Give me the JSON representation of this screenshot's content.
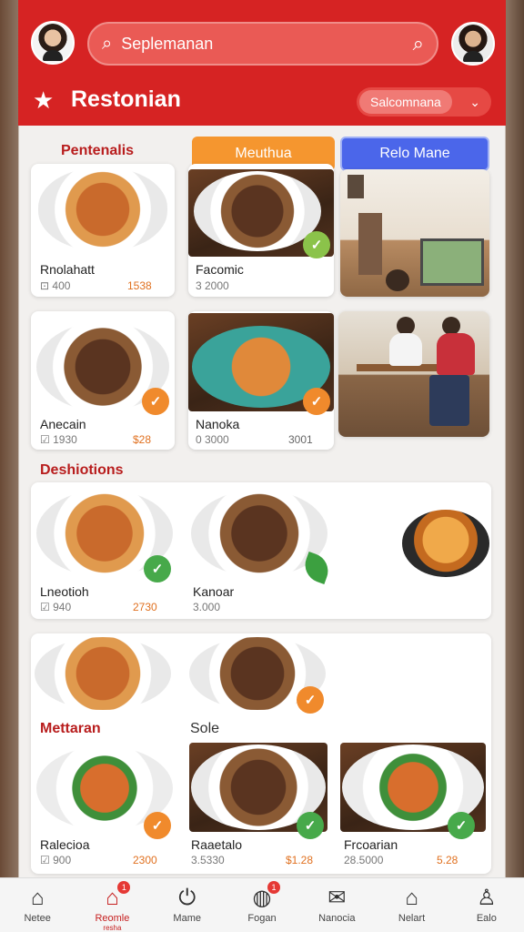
{
  "header": {
    "search_text": "Seplemanan",
    "brand_title": "Restonian",
    "select_value": "Salcomnana"
  },
  "sections": {
    "first": "Pentenalis",
    "second": "Deshiotions",
    "third_left": "Mettaran",
    "third_right": "Sole"
  },
  "tabs": [
    {
      "label": "Meuthua",
      "color": "#f5962f"
    },
    {
      "label": "Relo Mane",
      "color": "#4b66ea"
    }
  ],
  "cards": [
    {
      "name": "Rnolahatt",
      "meta": "400",
      "price": "1538"
    },
    {
      "name": "Facomic",
      "meta": "3 2000",
      "price": ""
    },
    {
      "name": "Anecain",
      "meta": "1930",
      "price": "$28"
    },
    {
      "name": "Nanoka",
      "meta": "0 3000",
      "price": "3001"
    },
    {
      "name": "Lneotioh",
      "meta": "940",
      "price": "2730"
    },
    {
      "name": "Kanoar",
      "meta": "3.000",
      "price": ""
    },
    {
      "name": "Ralecioa",
      "meta": "900",
      "price": "2300"
    },
    {
      "name": "Raaetalo",
      "meta": "3.5330",
      "price": "$1.28"
    },
    {
      "name": "Frcoarian",
      "meta": "28.5000",
      "price": "5.28"
    }
  ],
  "nav": [
    {
      "label": "Netee",
      "icon": "home-icon",
      "glyph": "⌂",
      "badge": ""
    },
    {
      "label": "Reomle",
      "icon": "store-icon",
      "glyph": "⌂",
      "badge": "1",
      "sub": "resha"
    },
    {
      "label": "Mame",
      "icon": "power-icon",
      "glyph": "⏻",
      "badge": ""
    },
    {
      "label": "Fogan",
      "icon": "chat-icon",
      "glyph": "◍",
      "badge": "1"
    },
    {
      "label": "Nanocia",
      "icon": "mail-icon",
      "glyph": "✉",
      "badge": ""
    },
    {
      "label": "Nelart",
      "icon": "house-icon",
      "glyph": "⌂",
      "badge": ""
    },
    {
      "label": "Ealo",
      "icon": "person-icon",
      "glyph": "♙",
      "badge": ""
    }
  ],
  "colors": {
    "brand": "#d62323",
    "accent_orange": "#f5962f",
    "accent_blue": "#4b66ea"
  }
}
